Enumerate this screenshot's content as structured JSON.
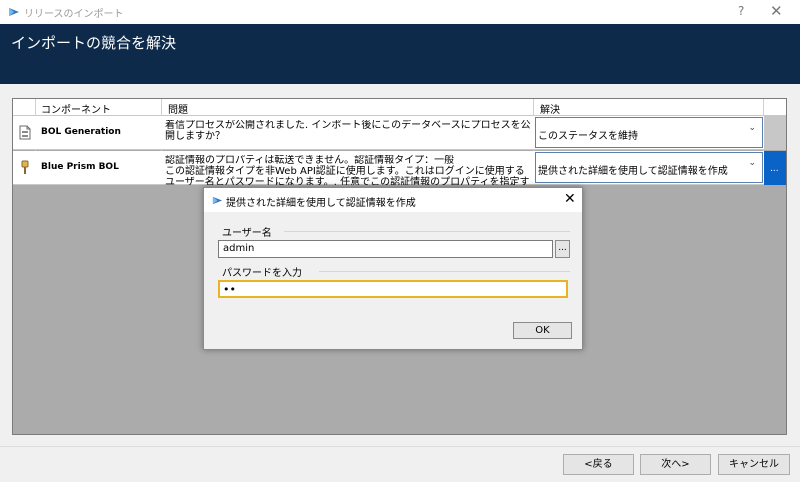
{
  "window": {
    "title": "リリースのインポート",
    "help_label": "?",
    "close_label": "✕",
    "icon": "blue-prism-icon"
  },
  "header": {
    "heading": "インポートの競合を解決"
  },
  "grid": {
    "columns": [
      "コンポーネント",
      "問題",
      "解決"
    ],
    "rows": [
      {
        "icon": "process-icon",
        "name": "BOL Generation",
        "issue": "着信プロセスが公開されました. インポート後にこのデータベースにプロセスを公開しますか？",
        "resolution": "このステータスを維持",
        "ellipsis": ""
      },
      {
        "icon": "object-icon",
        "name": "Blue Prism BOL",
        "issue": "認証情報のプロパティは転送できません。認証情報タイプ：一般\nこの認証情報タイプを非Web API認証に使用します。これはログインに使用するユーザー名とパスワードになります。. 任意でこの認証情報のプロパティを指定するか、インポートを",
        "resolution": "提供された詳細を使用して認証情報を作成",
        "ellipsis": "..."
      }
    ],
    "dropdown_icon": "chevron-down-icon"
  },
  "footer": {
    "back_label": "<戻る",
    "next_label": "次へ>",
    "cancel_label": "キャンセル"
  },
  "dialog": {
    "title": "提供された詳細を使用して認証情報を作成",
    "close_label": "✕",
    "username_label": "ユーザー名",
    "username_value": "admin",
    "browse_label": "...",
    "password_label": "パスワードを入力",
    "password_value": "••",
    "ok_label": "OK"
  },
  "colors": {
    "header_bg": "#0d2a4a",
    "selection_blue": "#0a64c8",
    "focus_yellow": "#e8b521"
  }
}
